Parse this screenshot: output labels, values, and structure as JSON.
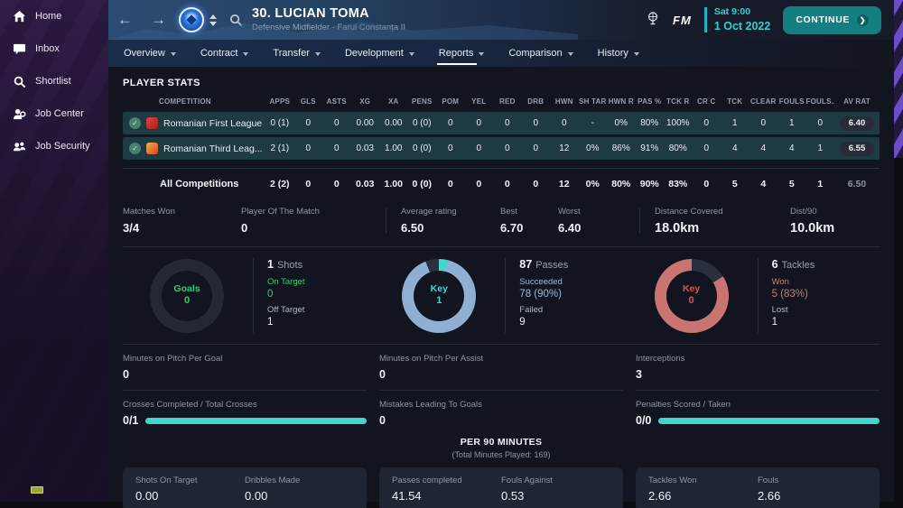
{
  "icons": {
    "back": "←",
    "forward": "→",
    "check": "✓",
    "continue_arrow": "❯"
  },
  "colors": {
    "accent_teal": "#3fd6cd",
    "green": "#2ecc71",
    "pass_blue": "#8fb0d2",
    "tackle_red": "#c97470",
    "continue_teal": "#147f80",
    "date_teal": "#35d0d4"
  },
  "sidebar": {
    "items": [
      {
        "icon": "home-icon",
        "label": "Home"
      },
      {
        "icon": "inbox-icon",
        "label": "Inbox"
      },
      {
        "icon": "shortlist-icon",
        "label": "Shortlist"
      },
      {
        "icon": "job-center-icon",
        "label": "Job Center"
      },
      {
        "icon": "job-security-icon",
        "label": "Job Security"
      }
    ]
  },
  "header": {
    "player_name": "30. LUCIAN TOMA",
    "player_subtitle": "Defensive Midfielder - Farul Constanța II",
    "fm_logo": "FM",
    "date_line1": "Sat 9:00",
    "date_line2": "1 Oct 2022",
    "continue_label": "CONTINUE"
  },
  "tabs": {
    "active": "Reports",
    "items": [
      {
        "label": "Overview"
      },
      {
        "label": "Contract"
      },
      {
        "label": "Transfer"
      },
      {
        "label": "Development"
      },
      {
        "label": "Reports"
      },
      {
        "label": "Comparison"
      },
      {
        "label": "History"
      }
    ]
  },
  "table": {
    "title": "PLAYER STATS",
    "columns": [
      "COMPETITION",
      "APPS",
      "GLS",
      "ASTS",
      "XG",
      "XA",
      "PENS",
      "POM",
      "YEL",
      "RED",
      "DRB",
      "HWN",
      "SH TAR",
      "HWN R",
      "PAS %",
      "TCK R",
      "CR C",
      "TCK",
      "CLEAR",
      "FOULS",
      "FOULS...",
      "AV RAT"
    ],
    "rows": [
      {
        "name": "Romanian First League",
        "v": [
          "0 (1)",
          "0",
          "0",
          "0.00",
          "0.00",
          "0 (0)",
          "0",
          "0",
          "0",
          "0",
          "0",
          "-",
          "0%",
          "80%",
          "100%",
          "0",
          "1",
          "0",
          "1",
          "0"
        ],
        "rating": "6.40"
      },
      {
        "name": "Romanian Third Leag...",
        "v": [
          "2 (1)",
          "0",
          "0",
          "0.03",
          "1.00",
          "0 (0)",
          "0",
          "0",
          "0",
          "0",
          "12",
          "0%",
          "86%",
          "91%",
          "80%",
          "0",
          "4",
          "4",
          "4",
          "1"
        ],
        "rating": "6.55"
      }
    ],
    "total": {
      "label": "All Competitions",
      "v": [
        "2 (2)",
        "0",
        "0",
        "0.03",
        "1.00",
        "0 (0)",
        "0",
        "0",
        "0",
        "0",
        "12",
        "0%",
        "80%",
        "90%",
        "83%",
        "0",
        "5",
        "4",
        "5",
        "1"
      ],
      "rating": "6.50"
    }
  },
  "summary": [
    {
      "label": "Matches Won",
      "value": "3/4"
    },
    {
      "label": "Player Of The Match",
      "value": "0"
    },
    {
      "label": "Average rating",
      "value": "6.50"
    },
    {
      "label": "Best",
      "value": "6.70"
    },
    {
      "label": "Worst",
      "value": "6.40"
    },
    {
      "label": "Distance Covered",
      "value": "18.0km"
    },
    {
      "label": "Dist/90",
      "value": "10.0km"
    }
  ],
  "donuts": {
    "goals": {
      "center_label": "Goals",
      "center_value": "0",
      "total": "1",
      "total_label": "Shots",
      "s1_label": "On Target",
      "s1_value": "0",
      "s2_label": "Off Target",
      "s2_value": "1"
    },
    "passes": {
      "center_label": "Key",
      "center_value": "1",
      "total": "87",
      "total_label": "Passes",
      "s1_label": "Succeeded",
      "s1_value": "78 (90%)",
      "s2_label": "Failed",
      "s2_value": "9"
    },
    "tackles": {
      "center_label": "Key",
      "center_value": "0",
      "total": "6",
      "total_label": "Tackles",
      "s1_label": "Won",
      "s1_value": "5 (83%)",
      "s2_label": "Lost",
      "s2_value": "1"
    }
  },
  "mid": [
    {
      "label": "Minutes on Pitch Per Goal",
      "value": "0"
    },
    {
      "label": "Minutes on Pitch Per Assist",
      "value": "0"
    },
    {
      "label": "Interceptions",
      "value": "3"
    }
  ],
  "prog": [
    {
      "label": "Crosses Completed / Total Crosses",
      "value": "0/1"
    },
    {
      "label": "Mistakes Leading To Goals",
      "value": "0"
    },
    {
      "label": "Penalties Scored / Taken",
      "value": "0/0"
    }
  ],
  "per90": {
    "title": "PER 90 MINUTES",
    "subtitle": "(Total Minutes Played: 169)",
    "cards": [
      [
        {
          "label": "Shots On Target",
          "value": "0.00"
        },
        {
          "label": "Dribbles Made",
          "value": "0.00"
        }
      ],
      [
        {
          "label": "Passes completed",
          "value": "41.54"
        },
        {
          "label": "Fouls Against",
          "value": "0.53"
        }
      ],
      [
        {
          "label": "Tackles Won",
          "value": "2.66"
        },
        {
          "label": "Fouls",
          "value": "2.66"
        }
      ]
    ]
  }
}
